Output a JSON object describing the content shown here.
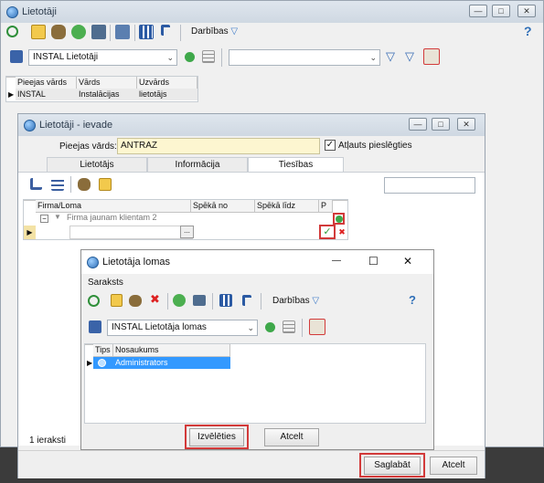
{
  "main": {
    "title": "Lietotāji",
    "help": "?",
    "actions_label": "Darbības",
    "filter_combo": "INSTAL Lietotāji",
    "search_combo": "",
    "columns": [
      "Pieejas vārds",
      "Vārds",
      "Uzvārds"
    ],
    "rows": [
      [
        "INSTAL",
        "Instalācijas",
        "lietotājs"
      ]
    ]
  },
  "edit": {
    "title": "Lietotāji - ievade",
    "login_label": "Pieejas vārds:",
    "login_value": "ANTRAZ",
    "allowed_label": "Atļauts pieslēgties",
    "tabs": [
      "Lietotājs",
      "Informācija",
      "Tiesības"
    ],
    "columns": [
      "Firma/Loma",
      "Spēkā no",
      "Spēkā līdz",
      "P"
    ],
    "group_row": "Firma jaunam klientam 2",
    "ellipsis": "...",
    "count": "1 ieraksti",
    "save": "Saglabāt",
    "cancel": "Atcelt"
  },
  "roles": {
    "title": "Lietotāja lomas",
    "section": "Saraksts",
    "actions_label": "Darbības",
    "help": "?",
    "filter_combo": "INSTAL Lietotāja lomas",
    "columns": [
      "Tips",
      "Nosaukums"
    ],
    "rows": [
      [
        "",
        "Administrators"
      ]
    ],
    "choose": "Izvēlēties",
    "cancel": "Atcelt",
    "min": "—",
    "max": "☐",
    "close": "✕"
  },
  "colors": {
    "accent": "#3399ff",
    "highlight_border": "#d23a3a"
  }
}
